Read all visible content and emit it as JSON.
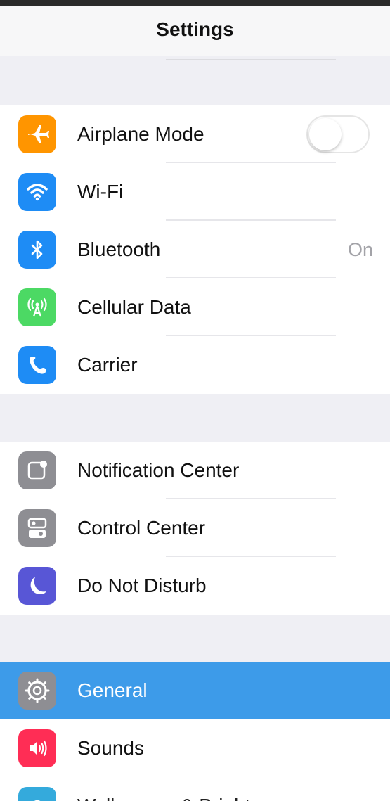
{
  "nav": {
    "title": "Settings"
  },
  "groups": [
    {
      "items": [
        {
          "label": "Airplane Mode",
          "icon": "airplane-icon",
          "color": "#ff9500",
          "control": "toggle-off"
        },
        {
          "label": "Wi-Fi",
          "icon": "wifi-icon",
          "color": "#1e8cf5"
        },
        {
          "label": "Bluetooth",
          "icon": "bluetooth-icon",
          "color": "#1e8cf5",
          "detail": "On"
        },
        {
          "label": "Cellular Data",
          "icon": "cellular-icon",
          "color": "#4cd964"
        },
        {
          "label": "Carrier",
          "icon": "phone-icon",
          "color": "#1e8cf5"
        }
      ]
    },
    {
      "items": [
        {
          "label": "Notification Center",
          "icon": "notification-center-icon",
          "color": "#8e8e93"
        },
        {
          "label": "Control Center",
          "icon": "control-center-icon",
          "color": "#8e8e93"
        },
        {
          "label": "Do Not Disturb",
          "icon": "moon-icon",
          "color": "#5856d6"
        }
      ]
    },
    {
      "items": [
        {
          "label": "General",
          "icon": "gear-icon",
          "color": "#8e8e93",
          "selected": true
        },
        {
          "label": "Sounds",
          "icon": "speaker-icon",
          "color": "#ff2d55"
        },
        {
          "label": "Wallpapers & Brightness",
          "icon": "wallpaper-icon",
          "color": "#34aadc"
        }
      ]
    }
  ],
  "colors": {
    "selection": "#3d9be9",
    "background": "#efeff4"
  }
}
